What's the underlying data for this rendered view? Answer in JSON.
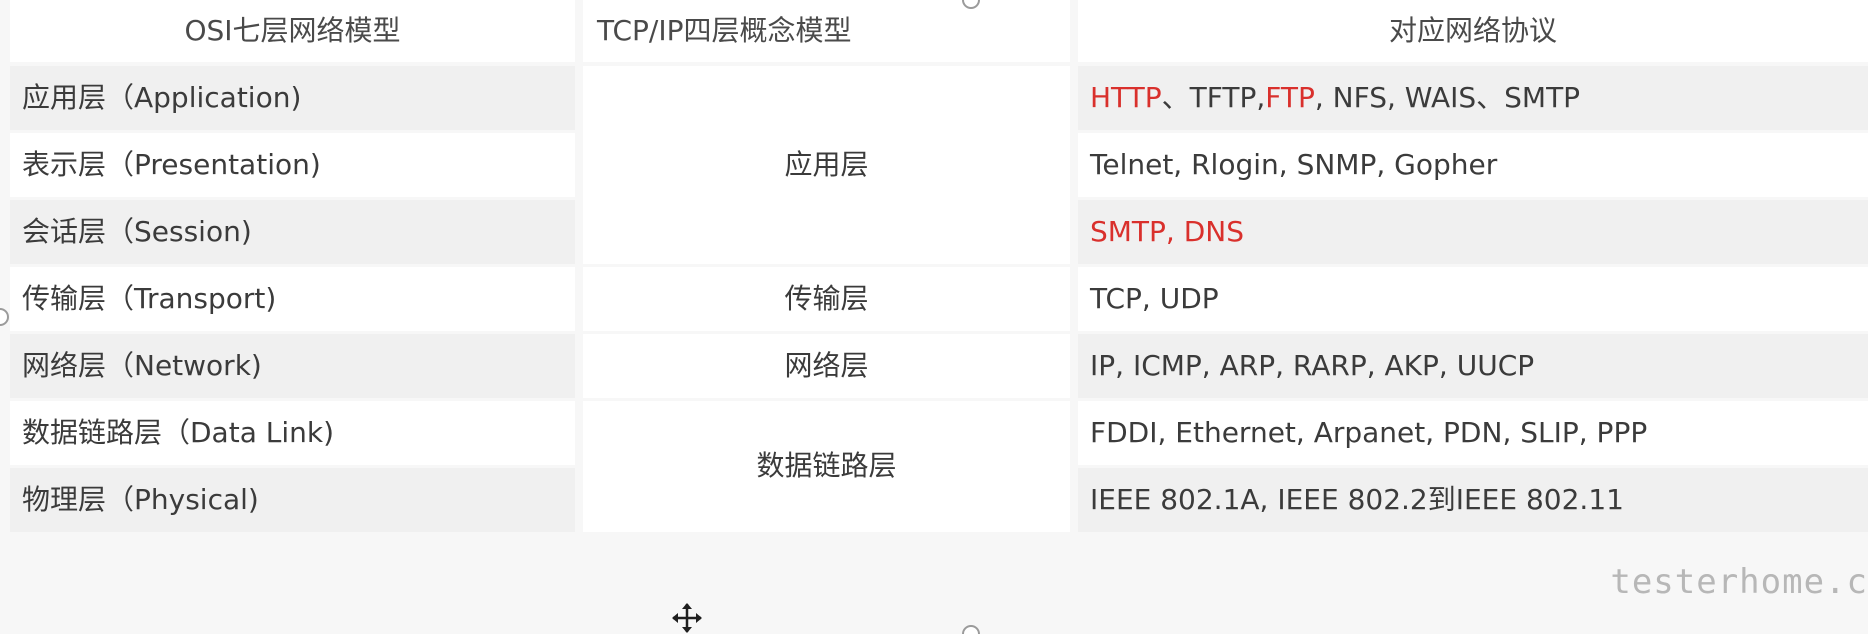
{
  "table": {
    "headers": {
      "osi": "OSI七层网络模型",
      "tcp": "TCP/IP四层概念模型",
      "protocols": "对应网络协议"
    },
    "osi_layers": [
      "应用层（Application)",
      "表示层（Presentation)",
      "会话层（Session)",
      "传输层（Transport)",
      "网络层（Network)",
      "数据链路层（Data Link)",
      "物理层（Physical)"
    ],
    "tcp_layers": [
      "应用层",
      "传输层",
      "网络层",
      "数据链路层"
    ],
    "protocol_rows": [
      {
        "parts": [
          {
            "text": "HTTP",
            "red": true
          },
          {
            "text": "、TFTP, ",
            "red": false
          },
          {
            "text": "FTP",
            "red": true
          },
          {
            "text": ", NFS, WAIS、SMTP",
            "red": false
          }
        ]
      },
      {
        "parts": [
          {
            "text": "Telnet, Rlogin, SNMP, Gopher",
            "red": false
          }
        ]
      },
      {
        "parts": [
          {
            "text": "SMTP, DNS",
            "red": true
          }
        ]
      },
      {
        "parts": [
          {
            "text": "TCP, UDP",
            "red": false
          }
        ]
      },
      {
        "parts": [
          {
            "text": "IP, ICMP, ARP, RARP, AKP, UUCP",
            "red": false
          }
        ]
      },
      {
        "parts": [
          {
            "text": "FDDI, Ethernet, Arpanet, PDN, SLIP, PPP",
            "red": false
          }
        ]
      },
      {
        "parts": [
          {
            "text": "IEEE 802.1A, IEEE 802.2到IEEE 802.11",
            "red": false
          }
        ]
      }
    ]
  },
  "watermark": "testerhome.c",
  "colors": {
    "highlight": "#d9302c",
    "text": "#3b3b3b"
  },
  "icons": {
    "move": "move-icon",
    "handle": "selection-handle"
  }
}
